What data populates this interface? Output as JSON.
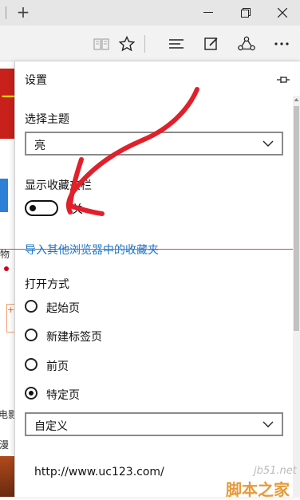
{
  "window": {
    "controls": [
      "minimize",
      "restore",
      "close"
    ]
  },
  "toolbar": {
    "icons": [
      "reading-view-icon",
      "favorite-star-icon",
      "hub-icon",
      "web-note-icon",
      "share-icon",
      "more-icon"
    ]
  },
  "background_page": {
    "fragments": [
      "物",
      "电影",
      "漫"
    ]
  },
  "settings": {
    "title": "设置",
    "theme": {
      "label": "选择主题",
      "value": "亮"
    },
    "favorites_bar": {
      "label": "显示收藏夹栏",
      "state_text": "关",
      "on": false
    },
    "import_link": "导入其他浏览器中的收藏夹",
    "open_with": {
      "label": "打开方式",
      "options": [
        {
          "label": "起始页",
          "selected": false
        },
        {
          "label": "新建标签页",
          "selected": false
        },
        {
          "label": "前页",
          "selected": false
        },
        {
          "label": "特定页",
          "selected": true
        }
      ],
      "page_select": "自定义",
      "url": "http://www.uc123.com/"
    }
  },
  "watermark": {
    "line1": "jb51.net",
    "line2": "脚本之家"
  },
  "annotation_color": "#e0202a"
}
